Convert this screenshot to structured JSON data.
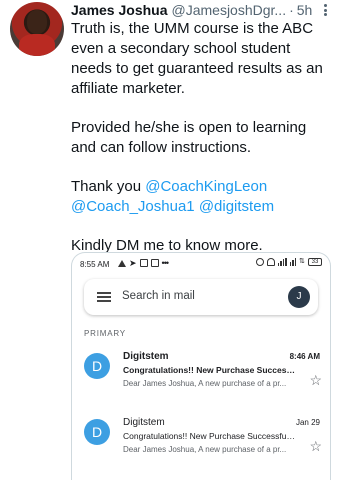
{
  "tweet": {
    "name": "James Joshua",
    "handle": "@JamesjoshDgr...",
    "separator": "·",
    "time": "5h",
    "line1": "Truth is, the UMM course is the ABC even a secondary school student needs to get guaranteed results as an affiliate marketer.",
    "line2": "Provided he/she is open to learning and can follow instructions.",
    "line3_prefix": "Thank you ",
    "mention1": "@CoachKingLeon",
    "mention2": "@Coach_Joshua1",
    "mention3": "@digitstem",
    "line4": "Kindly DM me to know more."
  },
  "phone": {
    "status_time": "8:55 AM",
    "status_dots": "•••",
    "battery": "33"
  },
  "gmail": {
    "search_placeholder": "Search in mail",
    "account_initial": "J",
    "section_label": "PRIMARY",
    "emails": [
      {
        "avatar": "D",
        "sender": "Digitstem",
        "subject": "Congratulations!! New Purchase Successfull...",
        "snippet": "Dear James Joshua, A new purchase of a pr...",
        "date": "8:46 AM",
        "unread": true
      },
      {
        "avatar": "D",
        "sender": "Digitstem",
        "subject": "Congratulations!! New Purchase Successfull...",
        "snippet": "Dear James Joshua, A new purchase of a pr...",
        "date": "Jan 29",
        "unread": false
      }
    ]
  },
  "icons": {
    "more": "more-icon",
    "menu": "menu-icon",
    "star": "star-icon"
  }
}
